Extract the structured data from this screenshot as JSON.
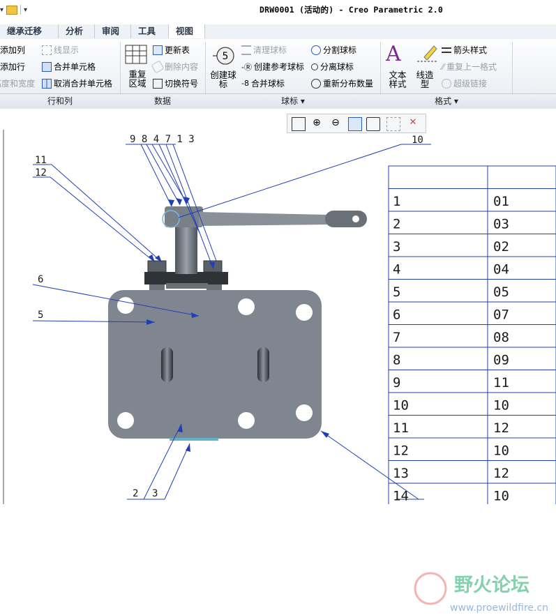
{
  "window": {
    "title": "DRW0001 (活动的) - Creo Parametric 2.0"
  },
  "tabs": [
    "继承迁移",
    "分析",
    "审阅",
    "工具",
    "视图"
  ],
  "ribbon": {
    "rows_cols": {
      "items": [
        "添加列",
        "添加行",
        "高度和宽度"
      ],
      "group": "行和列"
    },
    "data_left": {
      "items": [
        "线显示",
        "合并单元格",
        "取消合并单元格"
      ]
    },
    "data_big": {
      "label": "重复\n区域"
    },
    "data_right": {
      "items": [
        "更新表",
        "删除内容",
        "切换符号"
      ],
      "group": "数据"
    },
    "balloon_big": {
      "label": "创建球\n标",
      "badge": "5"
    },
    "balloon_mid": {
      "items": [
        "清理球标",
        "创建参考球标",
        "合并球标"
      ]
    },
    "balloon_right": {
      "items": [
        "分割球标",
        "分离球标",
        "重新分布数量"
      ],
      "group": "球标"
    },
    "format_text": {
      "label": "文本\n样式"
    },
    "format_line": {
      "label": "线造\n型"
    },
    "format_items": {
      "items": [
        "箭头样式",
        "重复上一格式",
        "超级链接"
      ],
      "group": "格式"
    }
  },
  "balloons": {
    "top": "9 8 4 7 1 3",
    "b10": "10",
    "b11": "11",
    "b12": "12",
    "b6": "6",
    "b5": "5",
    "b2": "2",
    "b3": "3"
  },
  "bom": {
    "rows": [
      [
        "1",
        "01"
      ],
      [
        "2",
        "03"
      ],
      [
        "3",
        "02"
      ],
      [
        "4",
        "04"
      ],
      [
        "5",
        "05"
      ],
      [
        "6",
        "07"
      ],
      [
        "7",
        "08"
      ],
      [
        "8",
        "09"
      ],
      [
        "9",
        "11"
      ],
      [
        "10",
        "10"
      ],
      [
        "11",
        "12"
      ],
      [
        "12",
        "10"
      ],
      [
        "13",
        "12"
      ],
      [
        "14",
        "10"
      ]
    ]
  },
  "watermark": {
    "cn": "野火论坛",
    "url": "www.proewildfire.cn"
  },
  "colors": {
    "plate": "#80868f",
    "accent_blue": "#1f3fb5",
    "tab_text": "#2d3a4a"
  }
}
